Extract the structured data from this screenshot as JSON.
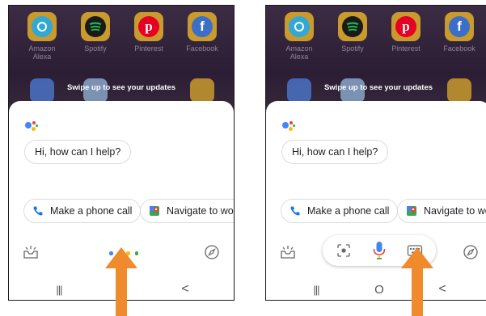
{
  "colors": {
    "app_tile": "#c99a2e",
    "alexa": "#31a8d6",
    "spotify": "#1db954",
    "pinterest": "#e60023",
    "facebook": "#3b6fc7",
    "google_blue": "#4285f4",
    "google_red": "#ea4335",
    "google_yellow": "#fbbc05",
    "google_green": "#34a853",
    "arrow": "#ef8b2c"
  },
  "screens": [
    {
      "apps": [
        {
          "label": "Amazon\nAlexa",
          "icon": "alexa-icon"
        },
        {
          "label": "Spotify",
          "icon": "spotify-icon"
        },
        {
          "label": "Pinterest",
          "icon": "pinterest-icon"
        },
        {
          "label": "Facebook",
          "icon": "facebook-icon"
        }
      ],
      "swipe_text": "Swipe up to see your updates",
      "greeting": "Hi, how can I help?",
      "chips": [
        "Make a phone call",
        "Navigate to work"
      ],
      "nav": {
        "recents": "|||",
        "back": "<"
      }
    },
    {
      "apps": [
        {
          "label": "Amazon\nAlexa",
          "icon": "alexa-icon"
        },
        {
          "label": "Spotify",
          "icon": "spotify-icon"
        },
        {
          "label": "Pinterest",
          "icon": "pinterest-icon"
        },
        {
          "label": "Facebook",
          "icon": "facebook-icon"
        }
      ],
      "swipe_text": "Swipe up to see your updates",
      "greeting": "Hi, how can I help?",
      "chips": [
        "Make a phone call",
        "Navigate to work"
      ],
      "nav": {
        "recents": "|||",
        "home": "O",
        "back": "<"
      }
    }
  ]
}
